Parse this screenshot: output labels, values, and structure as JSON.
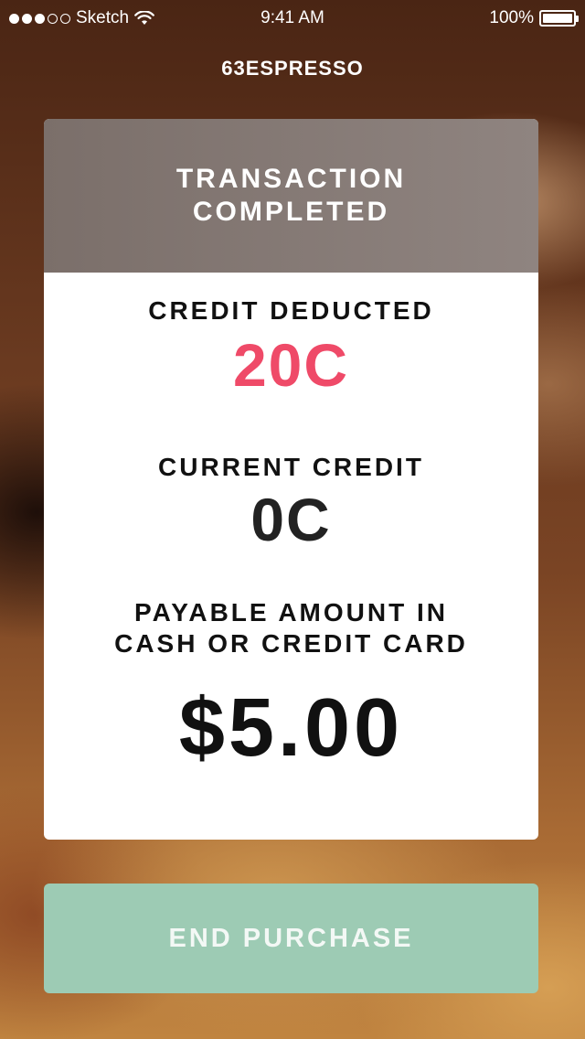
{
  "status_bar": {
    "carrier": "Sketch",
    "signal_strength": 3,
    "signal_max": 5,
    "time": "9:41 AM",
    "battery": "100%"
  },
  "app": {
    "title": "63ESPRESSO"
  },
  "card": {
    "header": "TRANSACTION COMPLETED",
    "credit_deducted_label": "CREDIT DEDUCTED",
    "credit_deducted_value": "20C",
    "current_credit_label": "CURRENT CREDIT",
    "current_credit_value": "0C",
    "payable_label": "PAYABLE AMOUNT IN CASH OR CREDIT CARD",
    "payable_value": "$5.00"
  },
  "actions": {
    "end_purchase_label": "END PURCHASE"
  },
  "colors": {
    "accent_red": "#ef4a68",
    "button_green": "#9dcbb4"
  }
}
